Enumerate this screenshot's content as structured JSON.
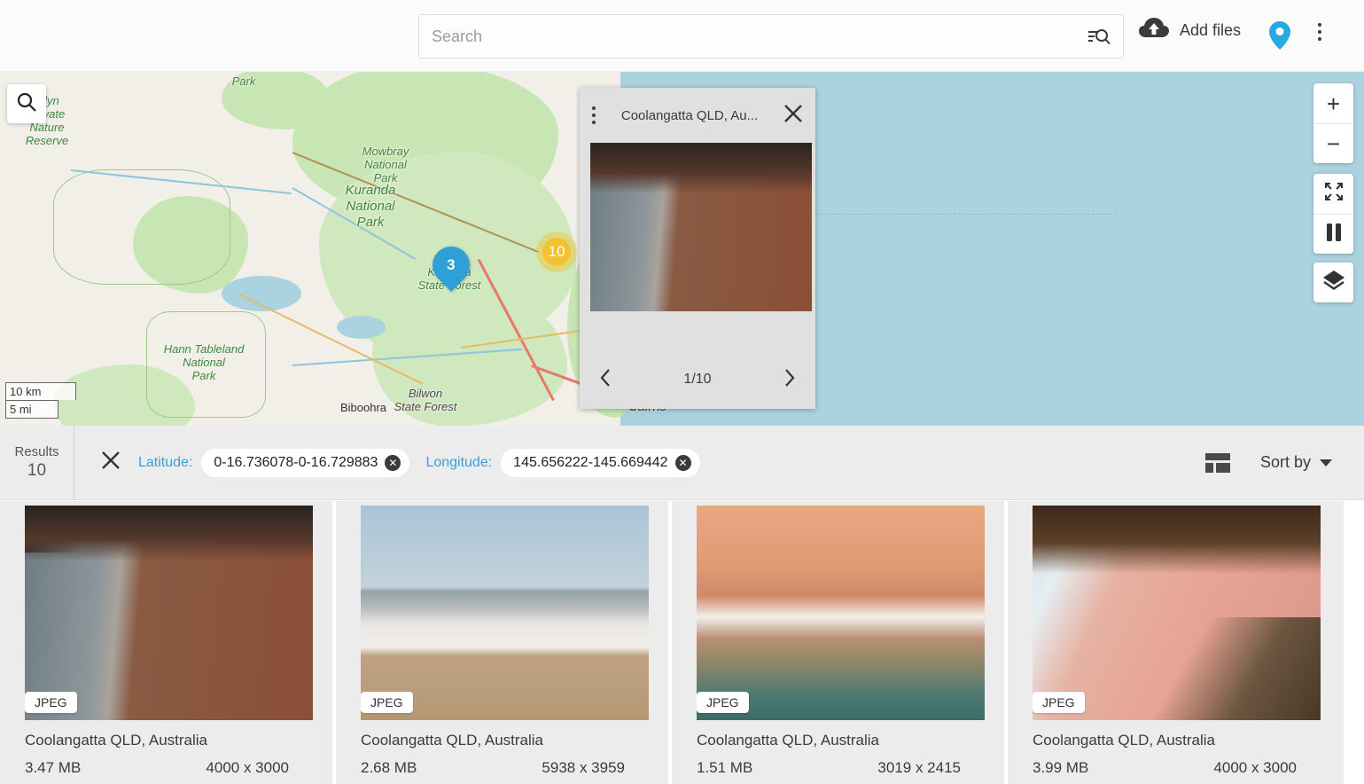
{
  "topbar": {
    "search_placeholder": "Search",
    "search_value": "",
    "search_icon": "search-list-icon",
    "add_files_label": "Add files",
    "upload_icon": "cloud-upload-icon",
    "map_pin_icon": "map-pin-icon",
    "overflow_icon": "kebab-menu-icon",
    "accent": "#29a9e1"
  },
  "map": {
    "search_icon": "magnifier-icon",
    "controls": {
      "zoom_in": "+",
      "zoom_out": "−",
      "fullscreen_icon": "expand-arrows-icon",
      "pause_icon": "pause-icon",
      "layers_icon": "layers-icon"
    },
    "scale": {
      "metric": "10 km",
      "imperial": "5 mi"
    },
    "markers": [
      {
        "type": "pin",
        "count": "3"
      },
      {
        "type": "cluster",
        "count": "10"
      }
    ],
    "labels": [
      {
        "text": "Park",
        "kind": "park"
      },
      {
        "text": "...lyn\nPrivate\nNature\nReserve",
        "kind": "park"
      },
      {
        "text": "Mowbray\nNational\nPark",
        "kind": "park"
      },
      {
        "text": "Kuranda\nNational\nPark",
        "kind": "park"
      },
      {
        "text": "Kuranda\nState Forest",
        "kind": "park"
      },
      {
        "text": "Hann Tableland\nNational\nPark",
        "kind": "park"
      },
      {
        "text": "Bilwon\nState Forest",
        "kind": "forest"
      },
      {
        "text": "Biboohra",
        "kind": "town"
      },
      {
        "text": "Cairns",
        "kind": "town"
      }
    ]
  },
  "popup": {
    "menu_icon": "kebab-menu-icon",
    "title": "Coolangatta QLD, Au...",
    "close_icon": "close-icon",
    "prev_icon": "chevron-left-icon",
    "next_icon": "chevron-right-icon",
    "counter": "1/10"
  },
  "filterbar": {
    "results_label": "Results",
    "results_count": "10",
    "clear_all_icon": "close-icon",
    "chips": [
      {
        "key": "Latitude:",
        "value": "0-16.736078-0-16.729883",
        "remove_icon": "remove-chip-icon"
      },
      {
        "key": "Longitude:",
        "value": "145.656222-145.669442",
        "remove_icon": "remove-chip-icon"
      }
    ],
    "layout_icon": "layout-grid-icon",
    "sort_label": "Sort by",
    "sort_caret_icon": "chevron-down-icon",
    "chip_key_color": "#3b9fd4"
  },
  "results": [
    {
      "badge": "JPEG",
      "title": "Coolangatta QLD, Australia",
      "size": "3.47 MB",
      "dimensions": "4000 x 3000",
      "thumb_class": "th1"
    },
    {
      "badge": "JPEG",
      "title": "Coolangatta QLD, Australia",
      "size": "2.68 MB",
      "dimensions": "5938 x 3959",
      "thumb_class": "th2"
    },
    {
      "badge": "JPEG",
      "title": "Coolangatta QLD, Australia",
      "size": "1.51 MB",
      "dimensions": "3019 x 2415",
      "thumb_class": "th3"
    },
    {
      "badge": "JPEG",
      "title": "Coolangatta QLD, Australia",
      "size": "3.99 MB",
      "dimensions": "4000 x 3000",
      "thumb_class": "th4"
    }
  ]
}
